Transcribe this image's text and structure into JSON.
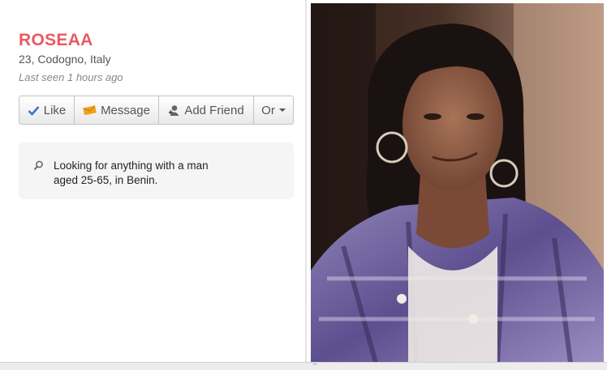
{
  "profile": {
    "name": "ROSEAA",
    "location": "23, Codogno, Italy",
    "last_seen": "Last seen 1 hours ago"
  },
  "actions": {
    "like_label": "Like",
    "message_label": "Message",
    "add_friend_label": "Add Friend",
    "or_label": "Or"
  },
  "looking_for": {
    "text": "Looking for anything with a man aged 25-65, in Benin."
  },
  "photo": {
    "icon": "profile-photo"
  },
  "colors": {
    "name": "#e85a5f",
    "like_icon": "#3b73c9",
    "message_icon": "#f0a21a"
  },
  "status_bar": {
    "grip": "'''"
  }
}
